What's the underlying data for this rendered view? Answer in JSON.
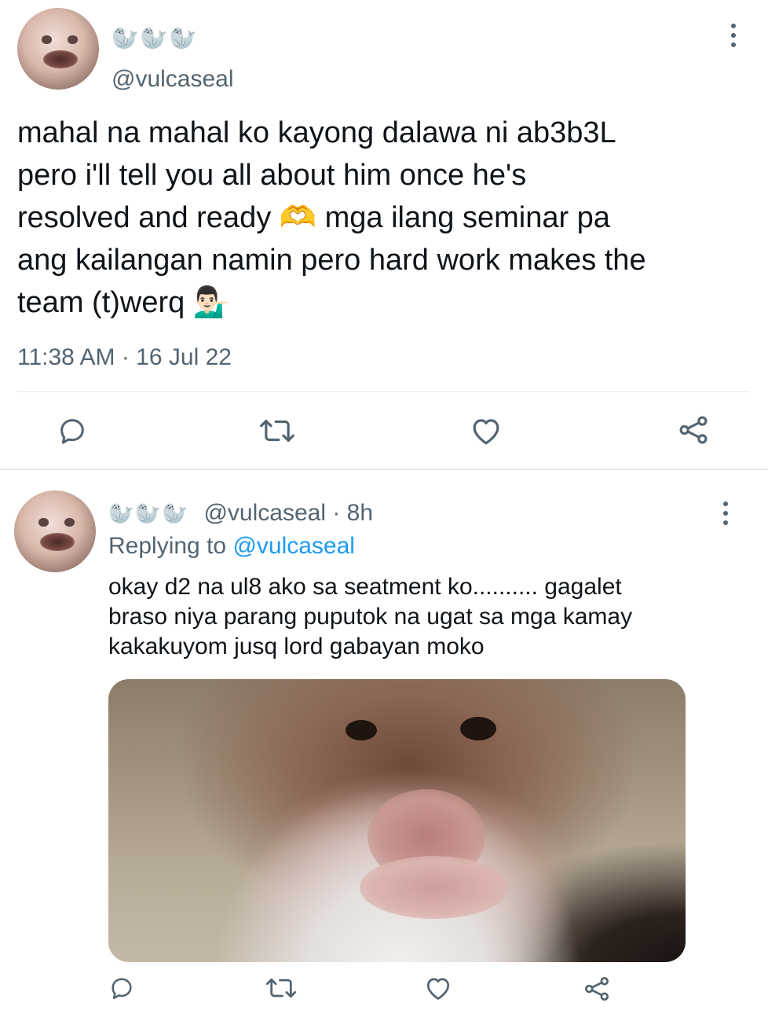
{
  "main_tweet": {
    "display_name": "🦭🦭🦭",
    "handle": "@vulcaseal",
    "text": "mahal na mahal ko kayong dalawa ni ab3b3L\npero i'll tell you all about him once he's\nresolved and ready 🫶 mga ilang seminar pa\nang kailangan namin pero hard work makes the\nteam (t)werq 💁🏻‍♂️",
    "timestamp": "11:38 AM · 16 Jul 22",
    "actions": [
      "reply-icon",
      "retweet-icon",
      "like-icon",
      "share-icon"
    ]
  },
  "reply_tweet": {
    "display_name": "🦭🦭🦭",
    "handle_time": "@vulcaseal · 8h",
    "replying_prefix": "Replying to ",
    "replying_handle": "@vulcaseal",
    "text_lines": [
      "okay d2 na ul8 ako sa seatment ko.......... gagalet",
      "braso niya parang puputok na ugat sa mga kamay",
      "kakakuyom jusq lord gabayan moko"
    ],
    "media": "hamster-photo",
    "actions": [
      "reply-icon",
      "retweet-icon",
      "like-icon",
      "share-icon"
    ]
  },
  "colors": {
    "text": "#0f1419",
    "secondary": "#536471",
    "link": "#1d9bf0",
    "divider": "#e3e7ea"
  }
}
